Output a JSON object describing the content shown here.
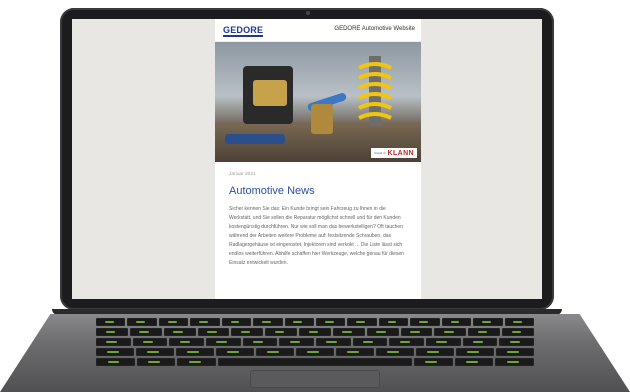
{
  "email": {
    "logo_text": "GEDORE",
    "site_label": "GEDORE Automotive Website",
    "hero_badge_small": "brand of",
    "hero_badge_brand": "KLANN",
    "date": "Januar 2021",
    "title": "Automotive News",
    "body": "Sicher kennen Sie das: Ein Kunde bringt sein Fahrzeug zu Ihnen in die Werkstatt, und Sie sollen die Reparatur möglichst schnell und für den Kunden kostengünstig durchführen. Nur wie soll man das bewerkstelligen? Oft tauchen während der Arbeiten weitere Probleme auf: festsitzende Schrauben, das Radlagergehäuse ist eingerostet, Injektoren sind verkokt ... Die Liste lässt sich endlos weiterführen. Abhilfe schaffen hier Werkzeuge, welche genau für diesen Einsatz entwickelt wurden."
  },
  "colors": {
    "brand_blue": "#2d4ea3",
    "logo_blue": "#1f3b8c",
    "klann_red": "#c3242a",
    "keyboard_backlight": "#7fbf3a"
  }
}
